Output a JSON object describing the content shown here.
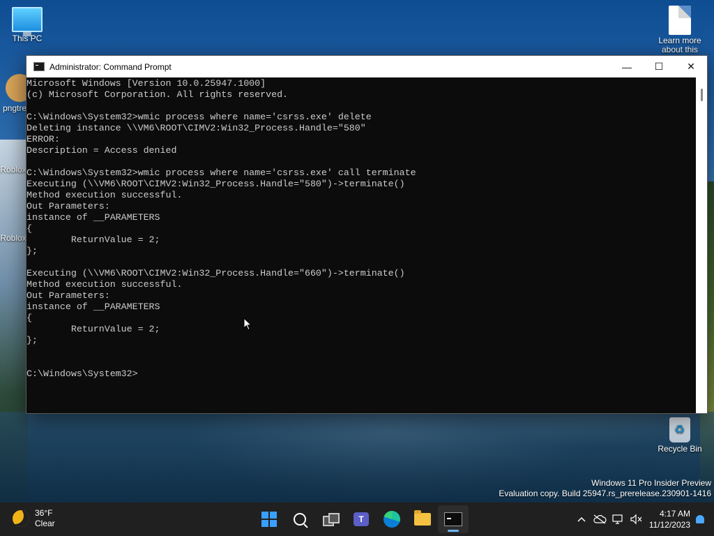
{
  "desktop": {
    "icons": [
      {
        "label": "This PC"
      },
      {
        "label": "Learn more about this picture"
      },
      {
        "label": "pngtre"
      },
      {
        "label": "Roblox"
      },
      {
        "label": "Roblox"
      },
      {
        "label": "Recycle Bin"
      }
    ],
    "watermark": {
      "line1": "Windows 11 Pro Insider Preview",
      "line2": "Evaluation copy. Build 25947.rs_prerelease.230901-1416"
    }
  },
  "window": {
    "title": "Administrator: Command Prompt",
    "minimize_glyph": "—",
    "maximize_glyph": "☐",
    "close_glyph": "✕",
    "console_lines": [
      "Microsoft Windows [Version 10.0.25947.1000]",
      "(c) Microsoft Corporation. All rights reserved.",
      "",
      "C:\\Windows\\System32>wmic process where name='csrss.exe' delete",
      "Deleting instance \\\\VM6\\ROOT\\CIMV2:Win32_Process.Handle=\"580\"",
      "ERROR:",
      "Description = Access denied",
      "",
      "C:\\Windows\\System32>wmic process where name='csrss.exe' call terminate",
      "Executing (\\\\VM6\\ROOT\\CIMV2:Win32_Process.Handle=\"580\")->terminate()",
      "Method execution successful.",
      "Out Parameters:",
      "instance of __PARAMETERS",
      "{",
      "        ReturnValue = 2;",
      "};",
      "",
      "Executing (\\\\VM6\\ROOT\\CIMV2:Win32_Process.Handle=\"660\")->terminate()",
      "Method execution successful.",
      "Out Parameters:",
      "instance of __PARAMETERS",
      "{",
      "        ReturnValue = 2;",
      "};",
      "",
      "",
      "C:\\Windows\\System32>"
    ]
  },
  "taskbar": {
    "weather": {
      "temp": "36°F",
      "condition": "Clear"
    },
    "apps": [
      {
        "name": "start",
        "active": false
      },
      {
        "name": "search",
        "active": false
      },
      {
        "name": "task-view",
        "active": false
      },
      {
        "name": "teams",
        "label": "T",
        "active": false
      },
      {
        "name": "edge",
        "active": false
      },
      {
        "name": "file-explorer",
        "active": false
      },
      {
        "name": "command-prompt",
        "active": true
      }
    ],
    "tray": {
      "chevron": "^",
      "time": "4:17 AM",
      "date": "11/12/2023"
    }
  },
  "colors": {
    "accent": "#3aa0ff",
    "console_bg": "#0c0c0c",
    "console_text": "#cccccc",
    "taskbar_bg": "#202020"
  }
}
